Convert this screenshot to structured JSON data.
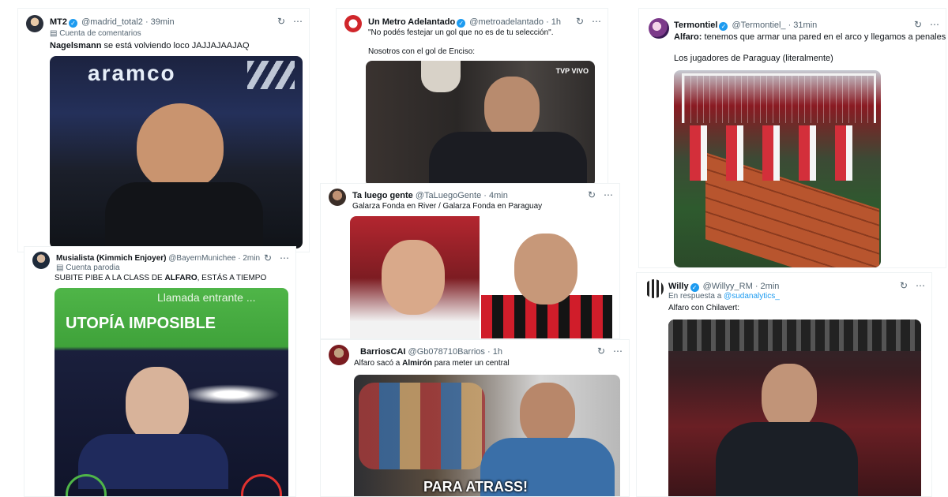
{
  "icons": {
    "verified": "✓",
    "grok": "↻",
    "more": "⋯"
  },
  "tweets": [
    {
      "name": "MT2",
      "handle": "@madrid_total2",
      "time": "· 39min",
      "sub": "Cuenta de comentarios",
      "text_bold": "Nagelsmann",
      "text_rest": " se está volviendo loco JAJJAJAAJAQ",
      "image_text": "aramco"
    },
    {
      "name": "Un Metro Adelantado",
      "handle": "@metroadelantado",
      "time": "· 1h",
      "text1": "\"No podés festejar un gol que no es de tu selección\".",
      "text2": "Nosotros con el gol de Enciso:",
      "image_text": "TVP VIVO"
    },
    {
      "name": "Termontiel",
      "handle": "@Termontiel_",
      "time": "· 31min",
      "text_bold": "Alfaro:",
      "text_rest": " tenemos que armar una pared en el arco y llegamos a penales",
      "text2": "Los jugadores de Paraguay (literalmente)"
    },
    {
      "name": "Ta luego gente",
      "handle": "@TaLuegoGente",
      "time": "· 4min",
      "text": "Galarza Fonda en River / Galarza Fonda en Paraguay"
    },
    {
      "name": "Musialista (Kimmich Enjoyer)",
      "handle": "@BayernMunichee",
      "time": "· 2min",
      "sub": "Cuenta parodia",
      "text_pre": "SUBITE PIBE A LA CLASS DE ",
      "text_bold": "ALFARO",
      "text_post": ", ESTÁS A TIEMPO",
      "image_top": "Llamada entrante ...",
      "image_title": "UTOPÍA IMPOSIBLE"
    },
    {
      "name": "BarriosCAI",
      "handle": "@Gb078710Barrios",
      "time": "· 1h",
      "text_pre": "Alfaro sacó a ",
      "text_bold": "Almirón",
      "text_post": " para meter un central",
      "image_caption": "PARA ATRASS!"
    },
    {
      "name": "Willy",
      "handle": "@Willyy_RM",
      "time": "· 2min",
      "reply_label": "En respuesta a ",
      "reply_handle": "@sudanalytics_",
      "text": "Alfaro con Chilavert:"
    }
  ]
}
